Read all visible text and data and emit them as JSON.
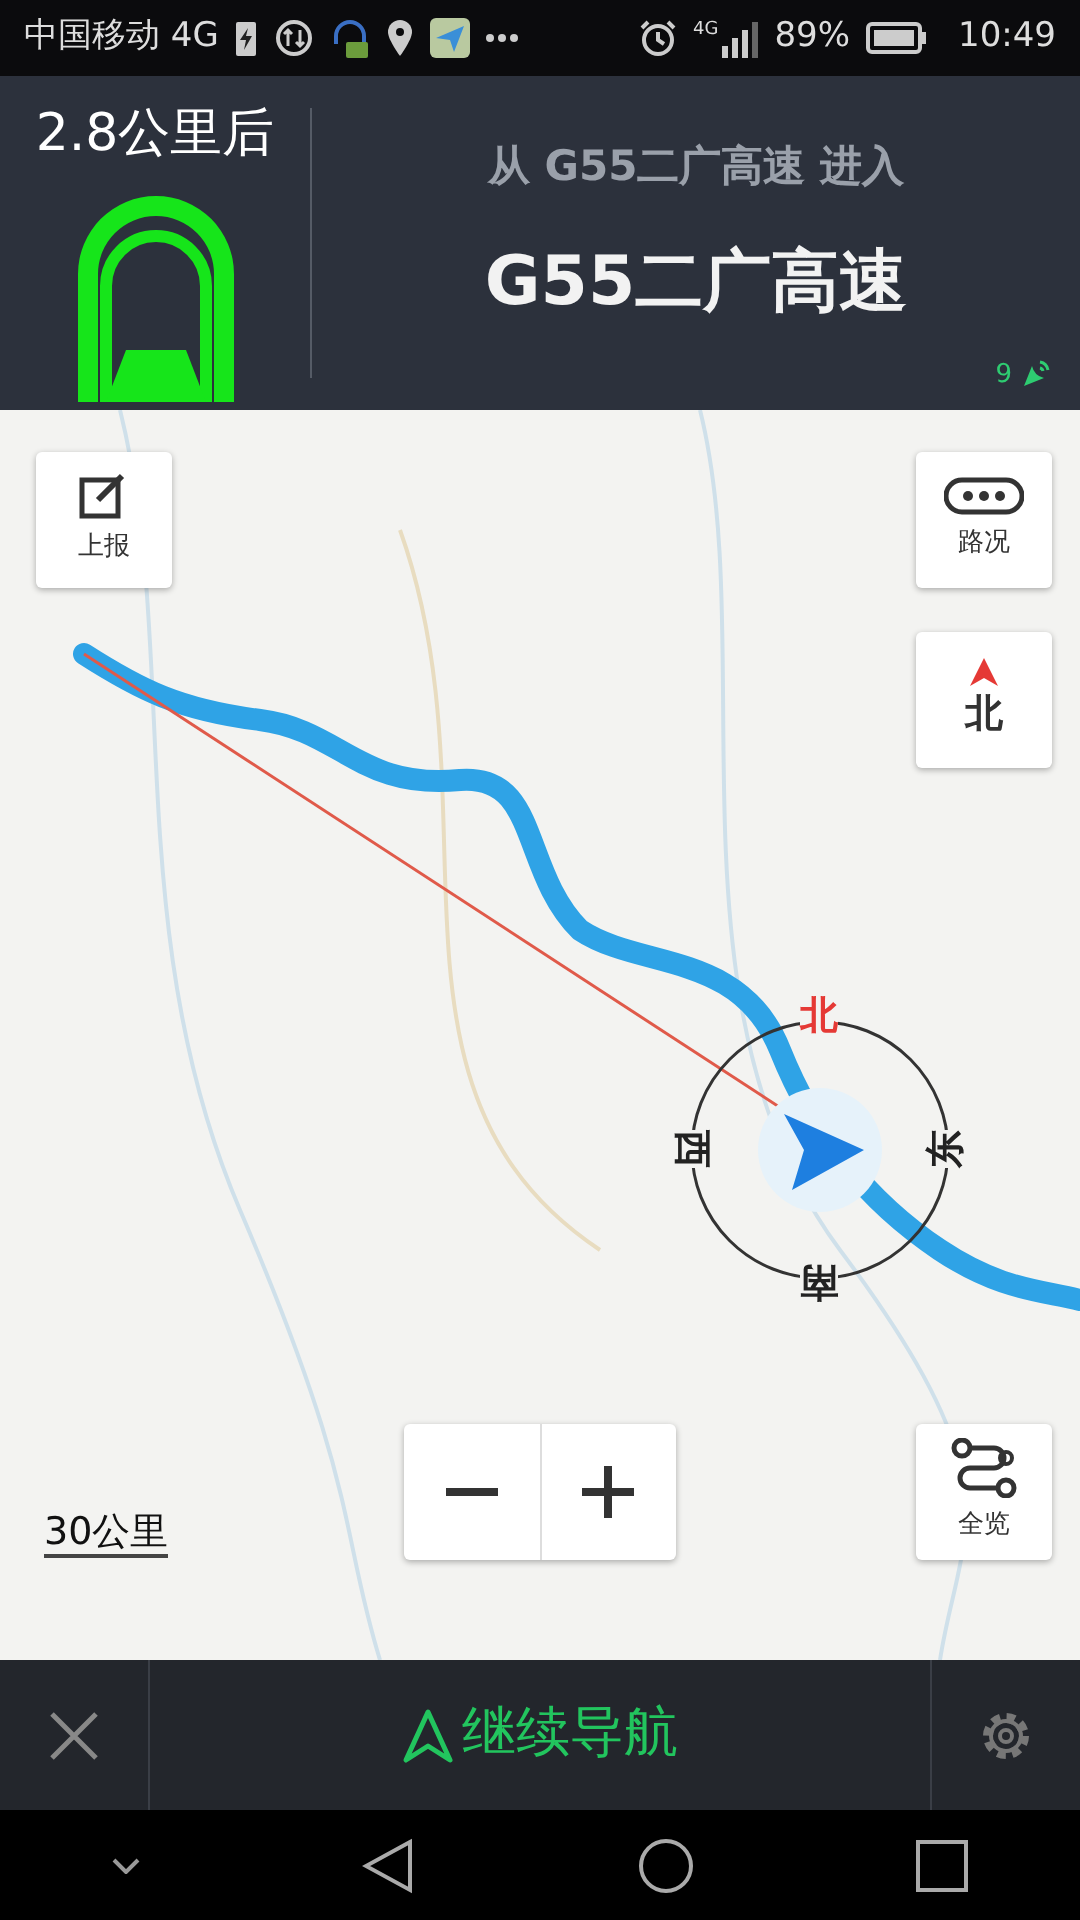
{
  "status_bar": {
    "carrier": "中国移动 4G",
    "network": "4G",
    "battery": "89%",
    "time": "10:49"
  },
  "guidance": {
    "distance": "2.8公里后",
    "enter_from": "从 G55二广高速 进入",
    "road": "G55二广高速",
    "satellites": "9"
  },
  "map_buttons": [
    {
      "kind": "report",
      "label": "上报"
    },
    {
      "kind": "traffic",
      "label": "路况"
    },
    {
      "kind": "north",
      "label": "北"
    },
    {
      "kind": "overview",
      "label": "全览"
    }
  ],
  "scale": "30公里",
  "compass": {
    "north": "北",
    "east": "东",
    "south": "南",
    "west": "西"
  },
  "bottom_bar": {
    "continue": "继续导航"
  }
}
